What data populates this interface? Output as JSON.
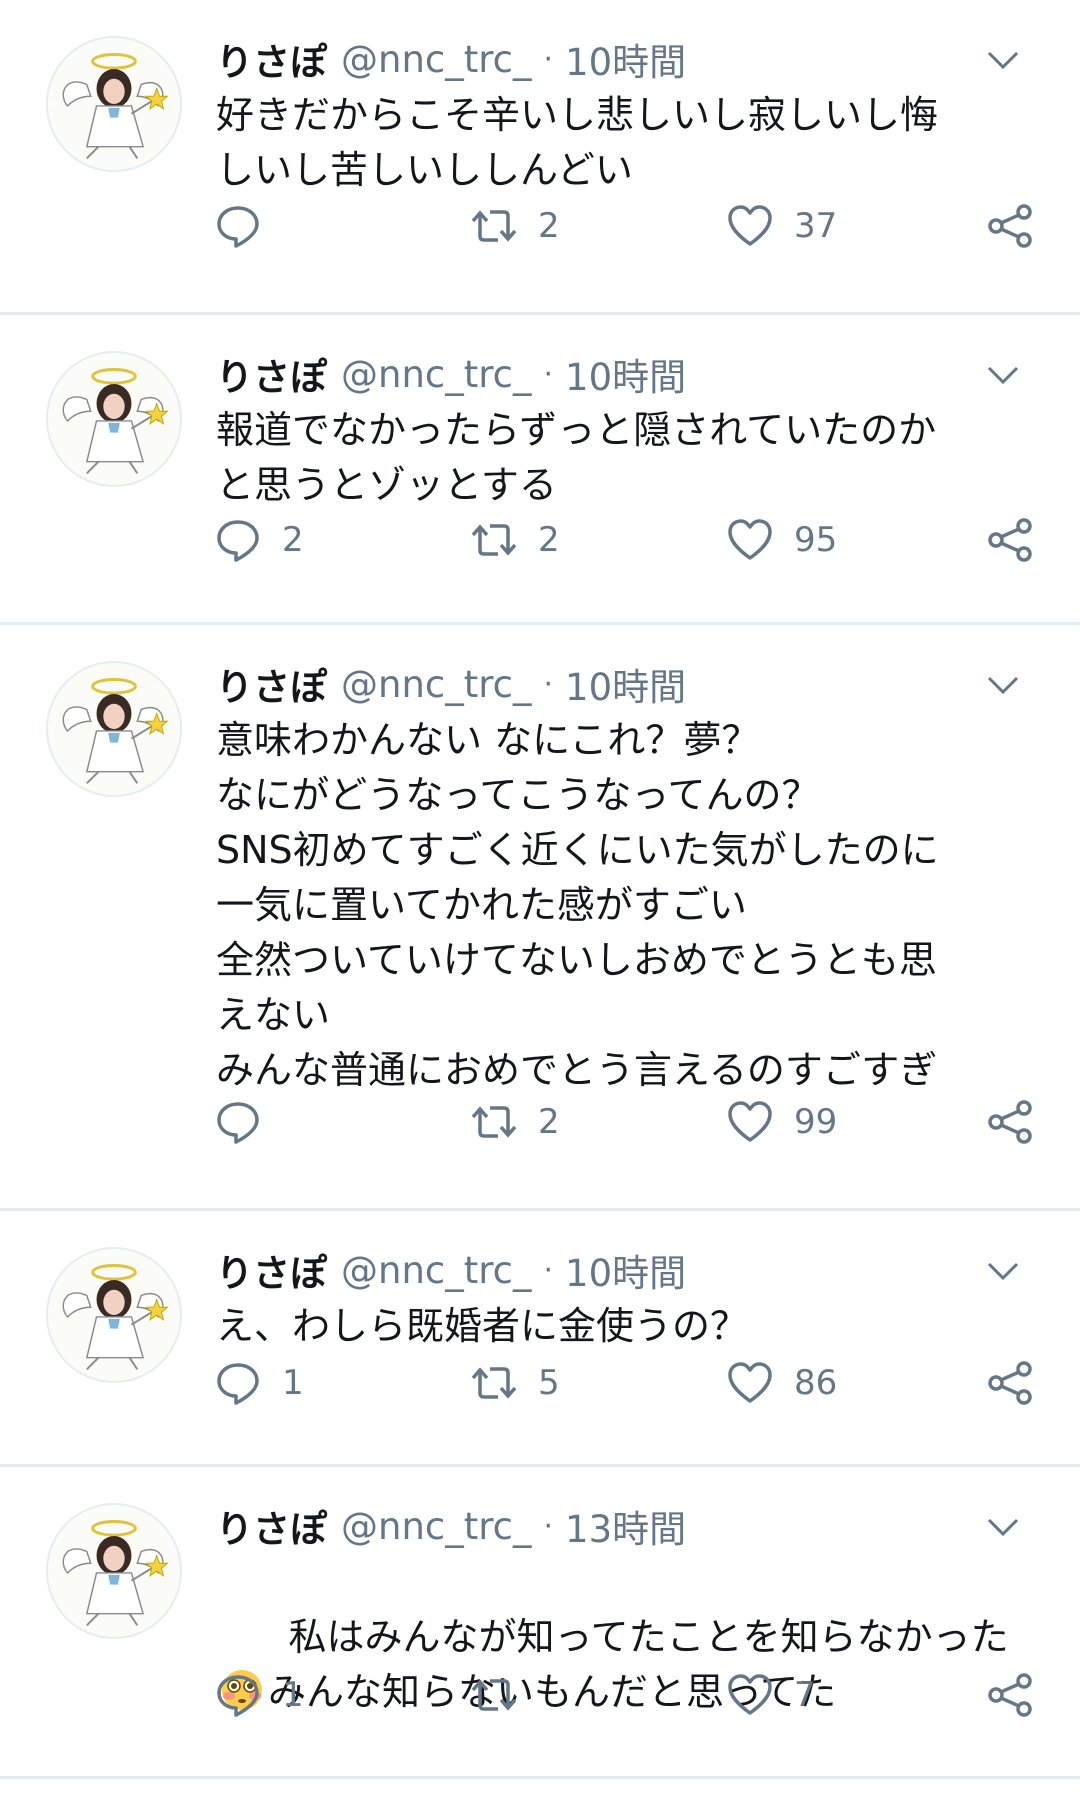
{
  "colors": {
    "text": "#14171a",
    "secondary": "#657786",
    "divider": "#e6ecf0",
    "icon": "#657786"
  },
  "icons": {
    "reply": "reply-icon",
    "retweet": "retweet-icon",
    "like": "heart-icon",
    "share": "share-icon",
    "menu": "chevron-down-icon",
    "avatar": "angel-avatar"
  },
  "tweets": [
    {
      "display_name": "りさぽ",
      "handle": "@nnc_trc_",
      "separator": "·",
      "time": "10時間",
      "text": "好きだからこそ辛いし悲しいし寂しいし悔\nしいし苦しいししんどい",
      "replies": "",
      "retweets": "2",
      "likes": "37"
    },
    {
      "display_name": "りさぽ",
      "handle": "@nnc_trc_",
      "separator": "·",
      "time": "10時間",
      "text": "報道でなかったらずっと隠されていたのか\nと思うとゾッとする",
      "replies": "2",
      "retweets": "2",
      "likes": "95"
    },
    {
      "display_name": "りさぽ",
      "handle": "@nnc_trc_",
      "separator": "·",
      "time": "10時間",
      "text": "意味わかんない なにこれ？夢？\nなにがどうなってこうなってんの？\nSNS初めてすごく近くにいた気がしたのに\n一気に置いてかれた感がすごい\n全然ついていけてないしおめでとうとも思\nえない\nみんな普通におめでとう言えるのすごすぎ",
      "replies": "",
      "retweets": "2",
      "likes": "99"
    },
    {
      "display_name": "りさぽ",
      "handle": "@nnc_trc_",
      "separator": "·",
      "time": "10時間",
      "text": "え、わしら既婚者に金使うの？",
      "replies": "1",
      "retweets": "5",
      "likes": "86"
    },
    {
      "display_name": "りさぽ",
      "handle": "@nnc_trc_",
      "separator": "·",
      "time": "13時間",
      "text_line1": "私はみんなが知ってたことを知らなかった",
      "emoji": "flushed-face-emoji",
      "text_line2": "みんな知らないもんだと思ってた",
      "replies": "1",
      "retweets": "",
      "likes": "7"
    }
  ]
}
